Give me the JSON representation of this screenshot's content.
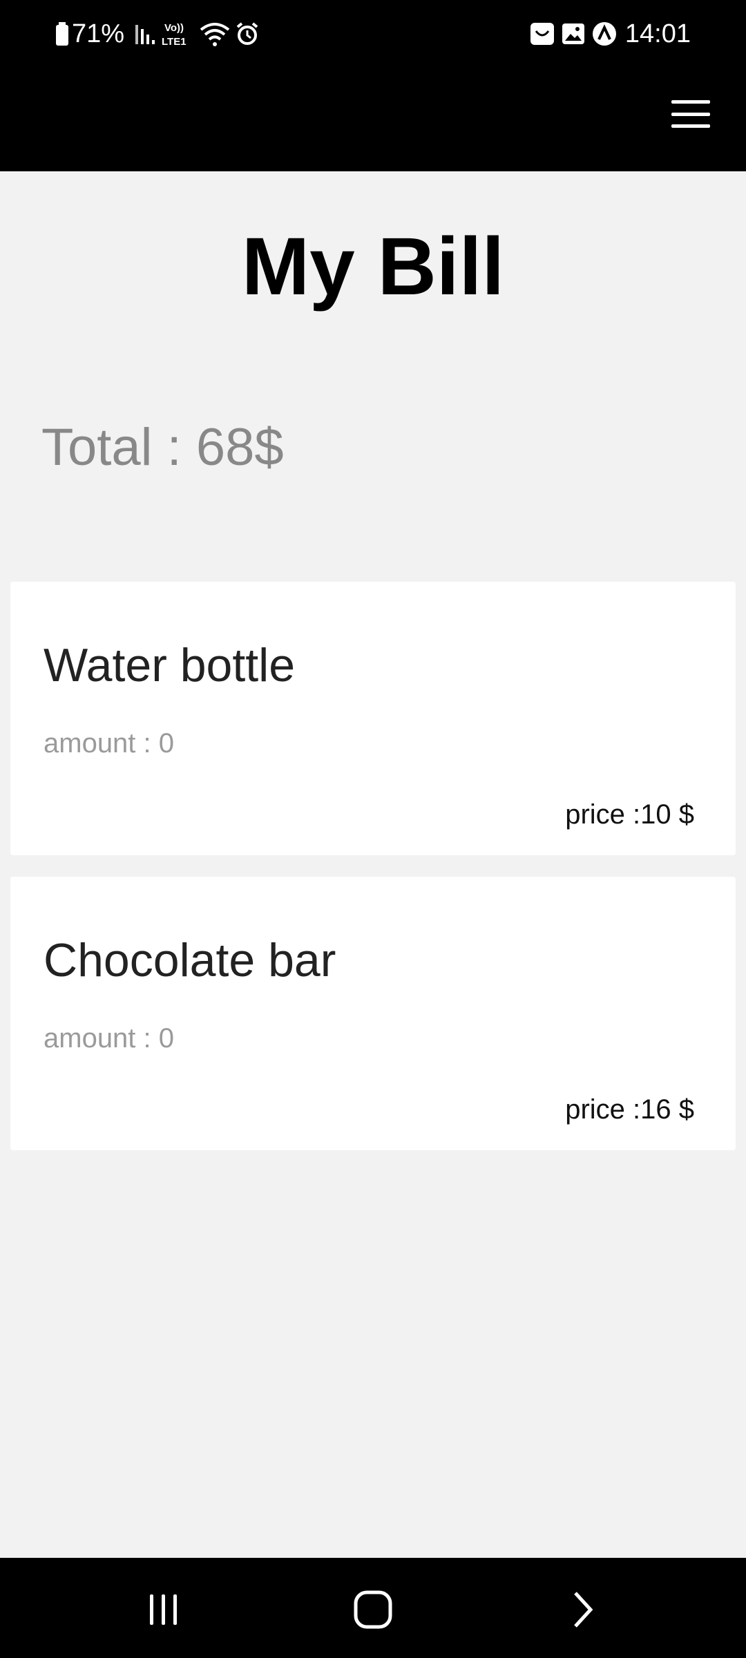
{
  "status_bar": {
    "battery": "71%",
    "network": "VoLTE1",
    "time": "14:01",
    "icons": [
      "battery-icon",
      "signal-icon",
      "volte-icon",
      "wifi-icon",
      "alarm-icon",
      "shop-icon",
      "gallery-icon",
      "app-icon"
    ]
  },
  "app_bar": {
    "menu_icon": "hamburger-menu-icon"
  },
  "page": {
    "title": "My Bill",
    "total": "Total : 68$"
  },
  "items": [
    {
      "name": "Water bottle",
      "amount": "amount : 0",
      "price": "price :10 $"
    },
    {
      "name": "Chocolate bar",
      "amount": "amount : 0",
      "price": "price :16 $"
    }
  ],
  "nav_bar": {
    "recent": "recent-apps-icon",
    "home": "home-icon",
    "back": "back-icon"
  }
}
